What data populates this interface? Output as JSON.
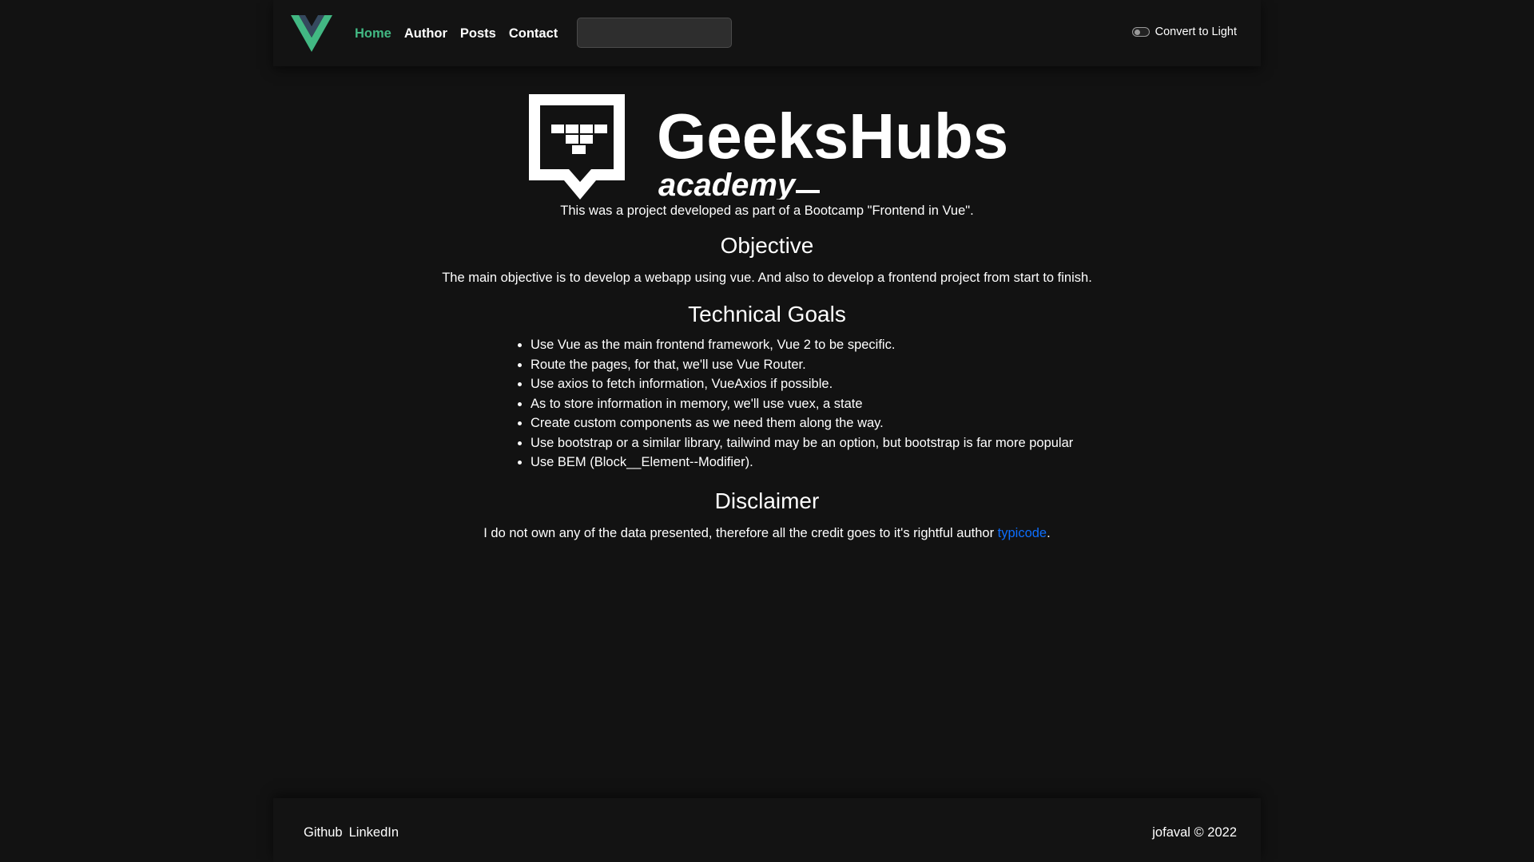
{
  "navbar": {
    "links": [
      {
        "label": "Home",
        "active": true
      },
      {
        "label": "Author"
      },
      {
        "label": "Posts"
      },
      {
        "label": "Contact"
      }
    ],
    "search": {
      "value": "",
      "placeholder": ""
    },
    "theme_toggle": {
      "label": "Convert to Light",
      "checked": false
    }
  },
  "brand": {
    "name": "GeeksHubs",
    "tagline": "academy"
  },
  "content": {
    "intro": "This was a project developed as part of a Bootcamp \"Frontend in Vue\".",
    "objective": {
      "heading": "Objective",
      "text": "The main objective is to develop a webapp using vue. And also to develop a frontend project from start to finish."
    },
    "goals": {
      "heading": "Technical Goals",
      "items": [
        "Use Vue as the main frontend framework, Vue 2 to be specific.",
        "Route the pages, for that, we'll use Vue Router.",
        "Use axios to fetch information, VueAxios if possible.",
        "As to store information in memory, we'll use vuex, a state",
        "Create custom components as we need them along the way.",
        "Use bootstrap or a similar library, tailwind may be an option, but bootstrap is far more popular",
        "Use BEM (Block__Element--Modifier)."
      ]
    },
    "disclaimer": {
      "heading": "Disclaimer",
      "text_before": "I do not own any of the data presented, therefore all the credit goes to it's rightful author ",
      "link": "typicode",
      "text_after": "."
    }
  },
  "footer": {
    "links": [
      "Github",
      "LinkedIn"
    ],
    "copyright": "jofaval © 2022"
  },
  "colors": {
    "background": "#121212",
    "vue_green": "#42b883",
    "vue_dark": "#35495e",
    "link_blue": "#0d6efd"
  },
  "icons": {
    "nav_logo": "vue-logo-icon",
    "brand_logo": "geekshubs-logo-icon"
  }
}
